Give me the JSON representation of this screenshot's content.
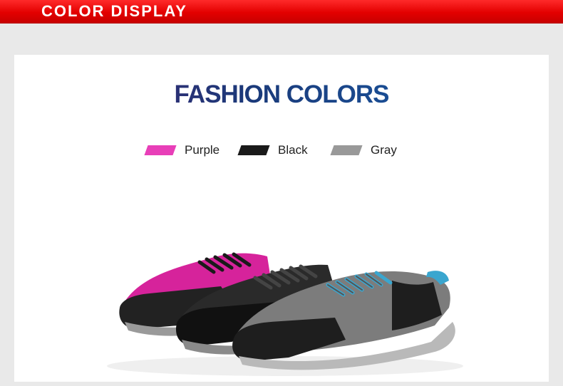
{
  "header": {
    "title": "COLOR DISPLAY",
    "band_color": "#e30000"
  },
  "main": {
    "title": "FASHION COLORS",
    "legend": [
      {
        "label": "Purple",
        "color": "#e83fb8"
      },
      {
        "label": "Black",
        "color": "#1a1a1a"
      },
      {
        "label": "Gray",
        "color": "#999999"
      }
    ],
    "image": {
      "icon": "three-sneakers-illustration",
      "colors": [
        "#d6239b",
        "#2a2a2a",
        "#7c7c7c"
      ],
      "accent": "#3aa6cf"
    }
  }
}
